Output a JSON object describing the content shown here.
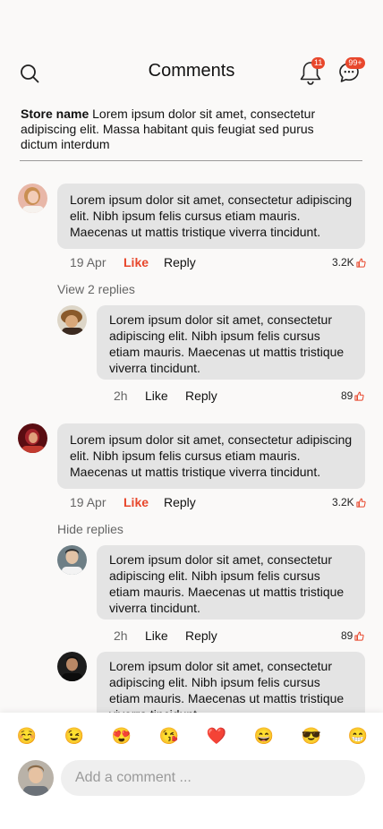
{
  "header": {
    "title": "Comments",
    "notifications_badge": "11",
    "messages_badge": "99+"
  },
  "post": {
    "store_name": "Store name",
    "text": "Lorem ipsum dolor sit amet, consectetur adipiscing elit. Massa habitant quis feugiat sed purus dictum interdum"
  },
  "comments": [
    {
      "lines": [
        "Lorem ipsum dolor sit amet, consectetur adipiscing",
        "elit. Nibh ipsum felis cursus etiam mauris.",
        "Maecenas ut mattis tristique viverra tincidunt."
      ],
      "date": "19 Apr",
      "like": "Like",
      "reply": "Reply",
      "likes": "3.2K",
      "toggle": "View 2 replies"
    },
    {
      "lines": [
        "Lorem ipsum dolor sit amet, consectetur adipiscing",
        "elit. Nibh ipsum felis cursus etiam mauris.",
        "Maecenas ut mattis tristique viverra tincidunt."
      ],
      "date": "19 Apr",
      "like": "Like",
      "reply": "Reply",
      "likes": "3.2K",
      "toggle": "Hide replies"
    }
  ],
  "replies": [
    {
      "lines": [
        "Lorem ipsum dolor sit amet, consectetur",
        "adipiscing elit. Nibh ipsum felis cursus",
        "etiam mauris. Maecenas ut mattis tristique",
        "viverra tincidunt."
      ],
      "time": "2h",
      "like": "Like",
      "reply": "Reply",
      "likes": "89"
    },
    {
      "lines": [
        "Lorem ipsum dolor sit amet, consectetur",
        "adipiscing elit. Nibh ipsum felis cursus",
        "etiam mauris. Maecenas ut mattis tristique",
        "viverra tincidunt."
      ],
      "time": "2h",
      "like": "Like",
      "reply": "Reply",
      "likes": "89"
    },
    {
      "lines": [
        "Lorem ipsum dolor sit amet, consectetur",
        "adipiscing elit. Nibh ipsum felis cursus",
        "etiam mauris. Maecenas ut mattis tristique",
        "viverra tincidunt."
      ]
    }
  ],
  "emojis": [
    "☺️",
    "😉",
    "😍",
    "😘",
    "❤️",
    "😄",
    "😎",
    "😁"
  ],
  "composer": {
    "placeholder": "Add a comment ..."
  },
  "colors": {
    "accent": "#e8472c",
    "bubble": "#e4e4e4",
    "background": "#faf9f8"
  }
}
